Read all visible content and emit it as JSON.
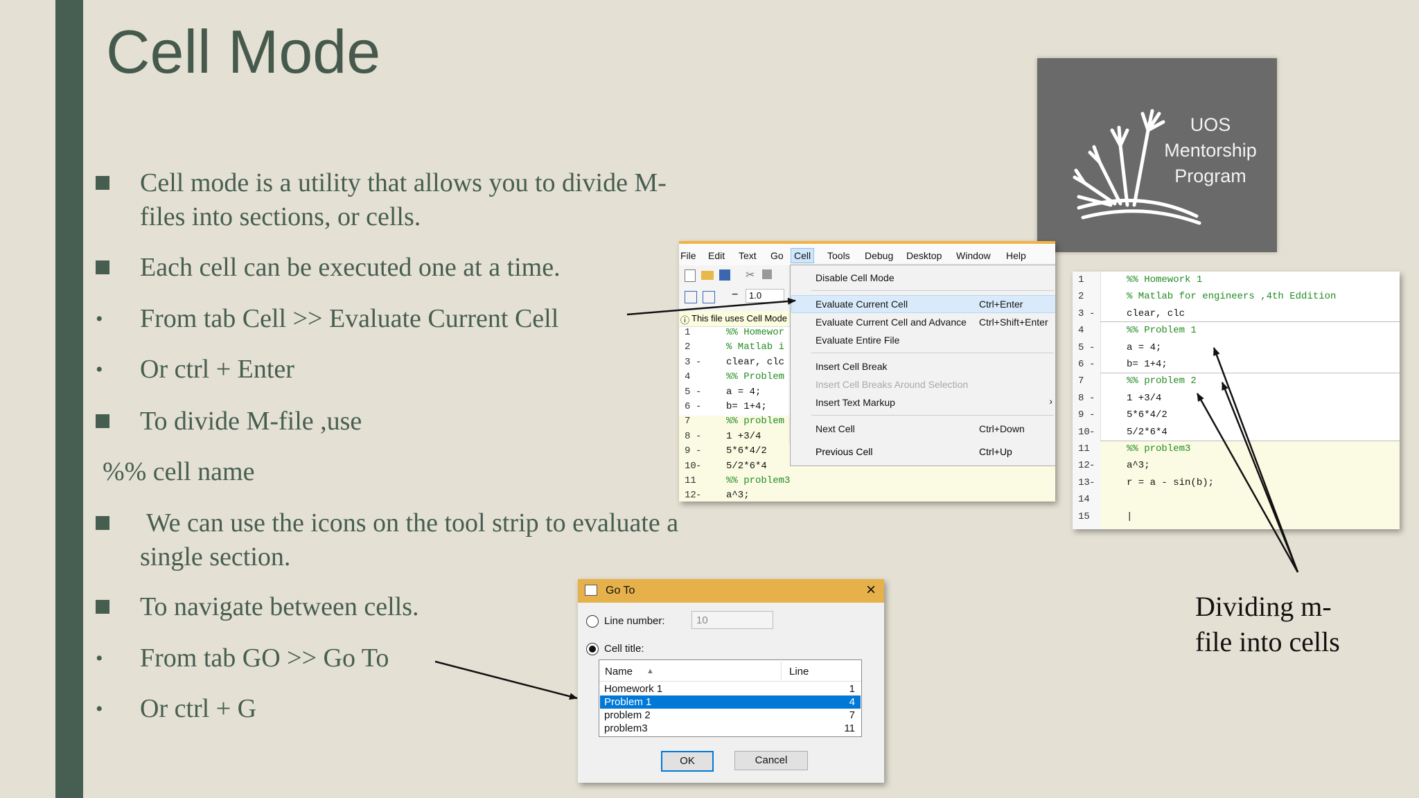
{
  "slide": {
    "title": "Cell Mode",
    "bullets": [
      {
        "type": "square",
        "lines": [
          "Cell mode is a utility that allows you to divide M-",
          "files into sections, or cells."
        ]
      },
      {
        "type": "square",
        "lines": [
          "Each cell can be executed one at a time."
        ]
      },
      {
        "type": "dot",
        "lines": [
          "From tab Cell >> Evaluate Current Cell"
        ]
      },
      {
        "type": "dot",
        "lines": [
          "Or ctrl + Enter"
        ]
      },
      {
        "type": "square",
        "lines": [
          "To divide M-file ,use"
        ]
      },
      {
        "type": "none",
        "lines": [
          "%% cell name"
        ]
      },
      {
        "type": "square",
        "lines": [
          " We can use the icons on the tool strip to evaluate a",
          "single section."
        ]
      },
      {
        "type": "square",
        "lines": [
          "To navigate between cells."
        ]
      },
      {
        "type": "dot",
        "lines": [
          "From tab GO >> Go To"
        ]
      },
      {
        "type": "dot",
        "lines": [
          "Or ctrl + G"
        ]
      }
    ],
    "caption_lines": [
      "Dividing m-",
      "file into cells"
    ]
  },
  "logo": {
    "lines": [
      "UOS",
      "Mentorship",
      "Program"
    ]
  },
  "editor1": {
    "menu": [
      "File",
      "Edit",
      "Text",
      "Go",
      "Cell",
      "Tools",
      "Debug",
      "Desktop",
      "Window",
      "Help"
    ],
    "active_menu": "Cell",
    "zoom_value": "1.0",
    "info_text": "This file uses Cell Mode",
    "dropdown": [
      {
        "label": "Disable Cell Mode",
        "shortcut": "",
        "disabled": false
      },
      {
        "label": "Evaluate Current Cell",
        "shortcut": "Ctrl+Enter",
        "disabled": false
      },
      {
        "label": "Evaluate Current Cell and Advance",
        "shortcut": "Ctrl+Shift+Enter",
        "disabled": false
      },
      {
        "label": "Evaluate Entire File",
        "shortcut": "",
        "disabled": false
      },
      {
        "label": "Insert Cell Break",
        "shortcut": "",
        "disabled": false
      },
      {
        "label": "Insert Cell Breaks Around Selection",
        "shortcut": "",
        "disabled": true
      },
      {
        "label": "Insert Text Markup",
        "shortcut": "",
        "disabled": false
      },
      {
        "label": "Next Cell",
        "shortcut": "Ctrl+Down",
        "disabled": false
      },
      {
        "label": "Previous Cell",
        "shortcut": "Ctrl+Up",
        "disabled": false
      }
    ],
    "code": [
      {
        "n": "1",
        "dash": "",
        "text": "%% Homewor",
        "comment": true
      },
      {
        "n": "2",
        "dash": "",
        "text": "% Matlab i",
        "comment": true
      },
      {
        "n": "3",
        "dash": "-",
        "text": "clear, clc",
        "comment": false
      },
      {
        "n": "4",
        "dash": "",
        "text": "%% Problem",
        "comment": true
      },
      {
        "n": "5",
        "dash": "-",
        "text": "a = 4;",
        "comment": false
      },
      {
        "n": "6",
        "dash": "-",
        "text": "b= 1+4;",
        "comment": false
      },
      {
        "n": "7",
        "dash": "",
        "text": "%% problem",
        "comment": true
      },
      {
        "n": "8",
        "dash": "-",
        "text": "1 +3/4",
        "comment": false
      },
      {
        "n": "9",
        "dash": "-",
        "text": "5*6*4/2",
        "comment": false
      },
      {
        "n": "10",
        "dash": "-",
        "text": "5/2*6*4",
        "comment": false
      },
      {
        "n": "11",
        "dash": "",
        "text": "%% problem3",
        "comment": true
      },
      {
        "n": "12",
        "dash": "-",
        "text": "a^3;",
        "comment": false
      }
    ]
  },
  "editor2": {
    "code": [
      {
        "n": "1",
        "dash": "",
        "text": "%% Homework 1",
        "comment": true
      },
      {
        "n": "2",
        "dash": "",
        "text": "% Matlab for engineers ,4th Eddition",
        "comment": true
      },
      {
        "n": "3",
        "dash": "-",
        "text": "clear, clc",
        "comment": false
      },
      {
        "n": "4",
        "dash": "",
        "text": "%% Problem 1",
        "comment": true
      },
      {
        "n": "5",
        "dash": "-",
        "text": "a = 4;",
        "comment": false
      },
      {
        "n": "6",
        "dash": "-",
        "text": "b= 1+4;",
        "comment": false
      },
      {
        "n": "7",
        "dash": "",
        "text": "%% problem 2",
        "comment": true
      },
      {
        "n": "8",
        "dash": "-",
        "text": "1 +3/4",
        "comment": false
      },
      {
        "n": "9",
        "dash": "-",
        "text": "5*6*4/2",
        "comment": false
      },
      {
        "n": "10",
        "dash": "-",
        "text": "5/2*6*4",
        "comment": false
      },
      {
        "n": "11",
        "dash": "",
        "text": "%% problem3",
        "comment": true
      },
      {
        "n": "12",
        "dash": "-",
        "text": "a^3;",
        "comment": false
      },
      {
        "n": "13",
        "dash": "-",
        "text": "r = a - sin(b);",
        "comment": false
      },
      {
        "n": "14",
        "dash": "",
        "text": "",
        "comment": false
      },
      {
        "n": "15",
        "dash": "",
        "text": "|",
        "comment": false
      }
    ]
  },
  "goto_dialog": {
    "title": "Go To",
    "line_number_label": "Line number:",
    "line_number_value": "10",
    "cell_title_label": "Cell title:",
    "selected_option": "Cell title",
    "col_name": "Name",
    "col_line": "Line",
    "rows": [
      {
        "name": "Homework 1",
        "line": "1"
      },
      {
        "name": "Problem 1",
        "line": "4"
      },
      {
        "name": "problem 2",
        "line": "7"
      },
      {
        "name": "problem3",
        "line": "11"
      }
    ],
    "selected_row": "Problem 1",
    "ok_label": "OK",
    "cancel_label": "Cancel"
  }
}
